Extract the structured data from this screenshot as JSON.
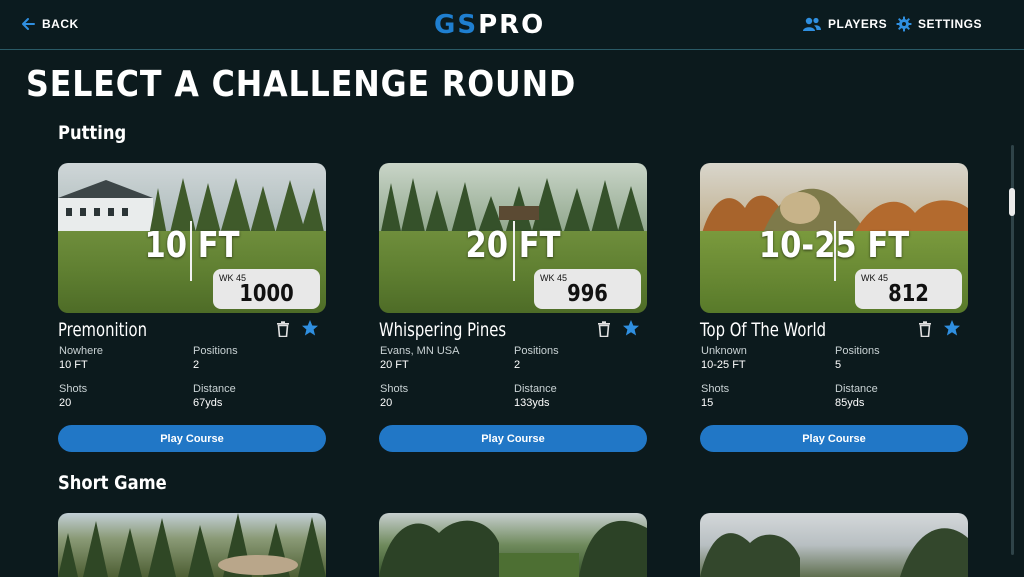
{
  "header": {
    "back_label": "BACK",
    "logo_gs": "GS",
    "logo_pro": "PRO",
    "players_label": "PLAYERS",
    "settings_label": "SETTINGS"
  },
  "page_title": "SELECT A CHALLENGE ROUND",
  "sections": [
    {
      "title": "Putting",
      "cards": [
        {
          "distance_overlay": "10 FT",
          "week": "WK 45",
          "score": "1000",
          "name": "Premonition",
          "location": "Nowhere",
          "length": "10 FT",
          "positions_label": "Positions",
          "positions": "2",
          "shots_label": "Shots",
          "shots": "20",
          "distance_label": "Distance",
          "distance": "67yds",
          "play_label": "Play Course"
        },
        {
          "distance_overlay": "20 FT",
          "week": "WK 45",
          "score": "996",
          "name": "Whispering Pines",
          "location": "Evans, MN USA",
          "length": "20 FT",
          "positions_label": "Positions",
          "positions": "2",
          "shots_label": "Shots",
          "shots": "20",
          "distance_label": "Distance",
          "distance": "133yds",
          "play_label": "Play Course"
        },
        {
          "distance_overlay": "10-25 FT",
          "week": "WK 45",
          "score": "812",
          "name": "Top Of The World",
          "location": "Unknown",
          "length": "10-25 FT",
          "positions_label": "Positions",
          "positions": "5",
          "shots_label": "Shots",
          "shots": "15",
          "distance_label": "Distance",
          "distance": "85yds",
          "play_label": "Play Course"
        }
      ]
    },
    {
      "title": "Short Game"
    }
  ],
  "colors": {
    "background": "#0c1a1d",
    "accent_blue": "#2177c6",
    "logo_blue": "#1f7fd0",
    "score_box": "#e8e8e8"
  },
  "icons": {
    "back": "arrow-left-icon",
    "players": "users-icon",
    "settings": "gear-icon",
    "delete": "trash-icon",
    "favorite": "star-icon"
  }
}
